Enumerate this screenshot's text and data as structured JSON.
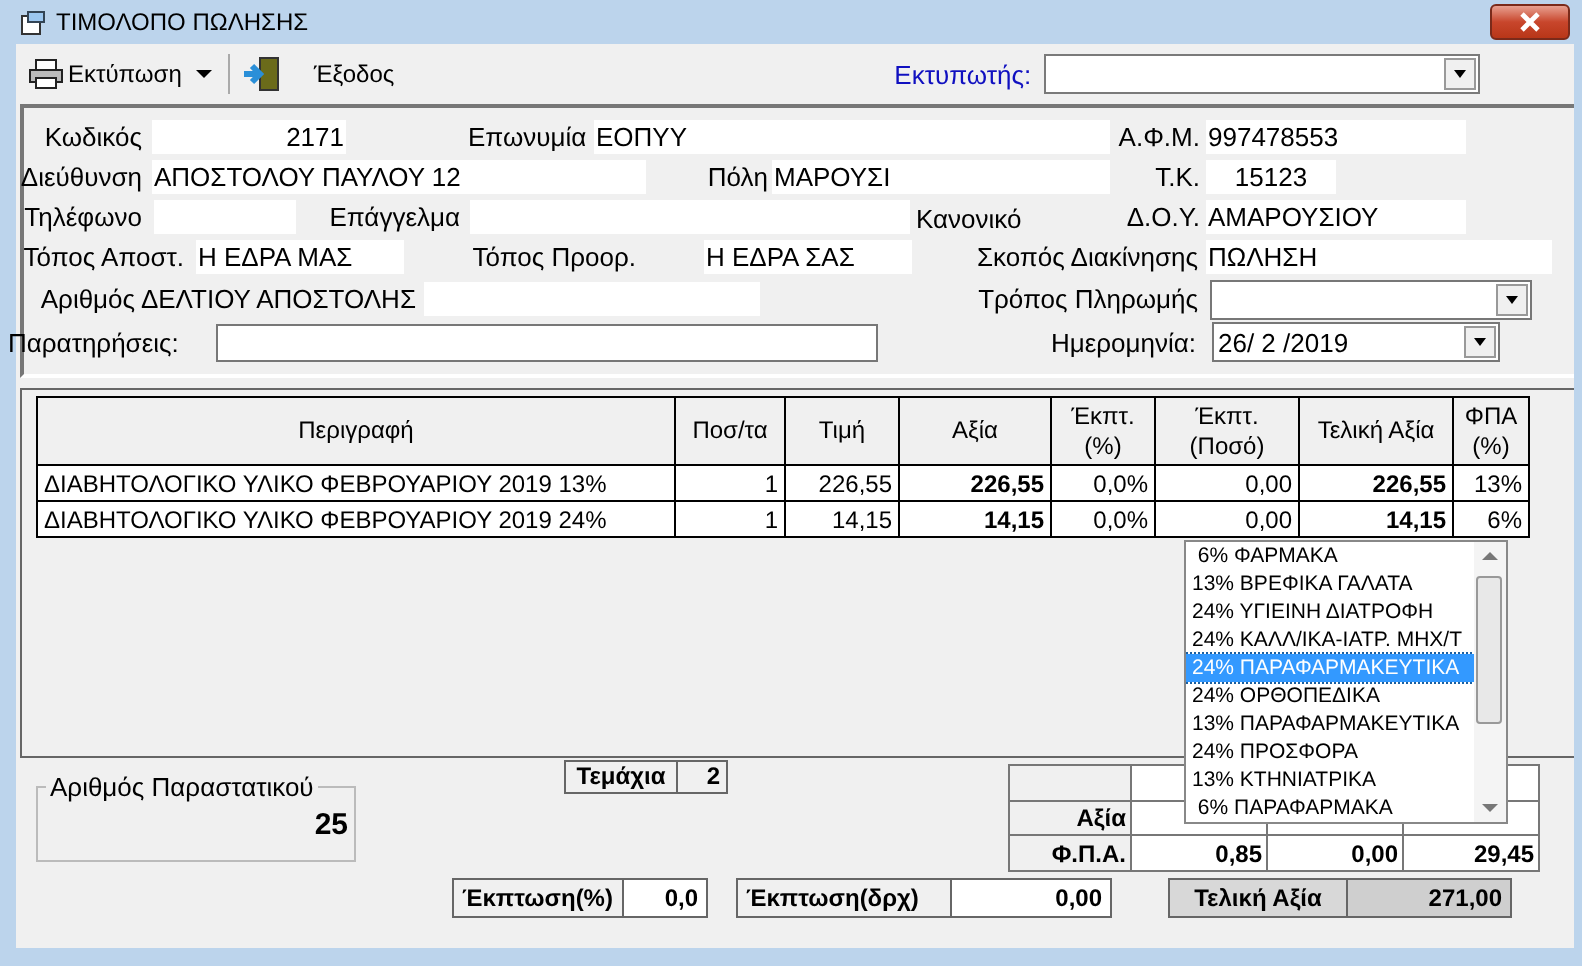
{
  "window": {
    "title": "ΤΙΜΟΛΟΠΟ ΠΩΛΗΣΗΣ"
  },
  "toolbar": {
    "print_button": "Εκτύπωση",
    "exit_button": "Έξοδος",
    "printer_label": "Εκτυπωτής:"
  },
  "form": {
    "rows": [
      [
        {
          "kind": "label",
          "text": "Κωδικός"
        },
        {
          "kind": "field",
          "value": "2171"
        },
        {
          "kind": "label",
          "text": "Επωνυμία"
        },
        {
          "kind": "field",
          "value": "ΕΟΠΥΥ"
        },
        {
          "kind": "label",
          "text": "Α.Φ.Μ."
        },
        {
          "kind": "field",
          "value": "997478553"
        }
      ],
      [
        {
          "kind": "label",
          "text": "Διεύθυνση"
        },
        {
          "kind": "field",
          "value": "ΑΠΟΣΤΟΛΟΥ ΠΑΥΛΟΥ 12"
        },
        {
          "kind": "label",
          "text": "Πόλη"
        },
        {
          "kind": "field",
          "value": "ΜΑΡΟΥΣΙ"
        },
        {
          "kind": "label",
          "text": "Τ.Κ."
        },
        {
          "kind": "field",
          "value": "15123"
        }
      ],
      [
        {
          "kind": "label",
          "text": "Τηλέφωνο"
        },
        {
          "kind": "field"
        },
        {
          "kind": "label",
          "text": "Επάγγελμα"
        },
        {
          "kind": "field",
          "suffix": "Κανονικό"
        },
        {
          "kind": "label",
          "text": "Δ.Ο.Υ."
        },
        {
          "kind": "field",
          "value": "ΑΜΑΡΟΥΣΙΟΥ"
        }
      ],
      [
        {
          "kind": "label",
          "text": "Τόπος Αποστ."
        },
        {
          "kind": "field",
          "value": "Η ΕΔΡΑ ΜΑΣ"
        },
        {
          "kind": "label",
          "text": "Τόπος Προορ."
        },
        {
          "kind": "field",
          "value": "Η ΕΔΡΑ ΣΑΣ"
        },
        {
          "kind": "label",
          "text": "Σκοπός Διακίνησης"
        },
        {
          "kind": "field",
          "value": "ΠΩΛΗΣΗ"
        }
      ],
      [
        {
          "kind": "label",
          "text": "Αριθμός ΔΕΛΤΙΟΥ ΑΠΟΣΤΟΛΗΣ"
        },
        {
          "kind": "field"
        },
        "",
        "",
        {
          "kind": "label",
          "text": "Τρόπος Πληρωμής"
        },
        {
          "kind": "combo"
        }
      ],
      [
        {
          "kind": "label",
          "text": "Παρατηρήσεις:"
        },
        {
          "kind": "box"
        },
        "",
        "",
        {
          "kind": "label",
          "text": "Ημερομηνία:"
        },
        {
          "kind": "combo",
          "value": "26/ 2 /2019"
        }
      ]
    ]
  },
  "table": {
    "columns": [
      {
        "label": "Περιγραφή",
        "bold": false
      },
      {
        "label": "Ποσ/τα",
        "bold": false
      },
      {
        "label": "Τιμή",
        "bold": false
      },
      {
        "label": "Αξία",
        "bold": true
      },
      {
        "label": "Έκπτ.\n(%)",
        "bold": false
      },
      {
        "label": "Έκπτ.\n(Ποσό)",
        "bold": false
      },
      {
        "label": "Τελική Αξία",
        "bold": true
      },
      {
        "label": "ΦΠΑ\n(%)",
        "bold": false
      }
    ],
    "rows": [
      [
        "ΔΙΑΒΗΤΟΛΟΓΙΚΟ ΥΛΙΚΟ ΦΕΒΡΟΥΑΡΙΟΥ 2019 13%",
        "1",
        "226,55",
        "226,55",
        "0,0%",
        "0,00",
        "226,55",
        "13%"
      ],
      [
        "ΔΙΑΒΗΤΟΛΟΓΙΚΟ ΥΛΙΚΟ ΦΕΒΡΟΥΑΡΙΟΥ 2019 24%",
        "1",
        "14,15",
        "14,15",
        "0,0%",
        "0,00",
        "14,15",
        "6%"
      ]
    ]
  },
  "dropdown": {
    "items": [
      {
        "label": " 6% ΦΑΡΜΑΚΑ",
        "selected": false
      },
      {
        "label": "13% ΒΡΕΦΙΚΑ ΓΑΛΑΤΑ",
        "selected": false
      },
      {
        "label": "24% ΥΓΙΕΙΝΗ ΔΙΑΤΡΟΦΗ",
        "selected": false
      },
      {
        "label": "24% ΚΑΛΛ/ΙΚΑ-ΙΑΤΡ. ΜΗΧ/Τ",
        "selected": false
      },
      {
        "label": "24% ΠΑΡΑΦΑΡΜΑΚΕΥΤΙΚΑ",
        "selected": true
      },
      {
        "label": "24% ΟΡΘΟΠΕΔΙΚΑ",
        "selected": false
      },
      {
        "label": "13% ΠΑΡΑΦΑΡΜΑΚΕΥΤΙΚΑ",
        "selected": false
      },
      {
        "label": "24% ΠΡΟΣΦΟΡΑ",
        "selected": false
      },
      {
        "label": "13% ΚΤΗΝΙΑΤΡΙΚΑ",
        "selected": false
      },
      {
        "label": " 6% ΠΑΡΑΦΑΡΜΑΚΑ",
        "selected": false
      }
    ]
  },
  "pieces": {
    "label": "Τεμάχια",
    "value": "2"
  },
  "document_number": {
    "label": "Αριθμός Παραστατικού",
    "value": "25"
  },
  "summary": {
    "rows": [
      {
        "label": "Αξία"
      },
      {
        "label": "Φ.Π.Α.",
        "values": [
          "0,85",
          "0,00",
          "29,45"
        ]
      }
    ]
  },
  "totals": {
    "discount_percent_label": "Έκπτωση(%)",
    "discount_percent": "0,0",
    "discount_amount_label": "Έκπτωση(δρχ)",
    "discount_amount": "0,00",
    "final_label": "Τελική Αξία",
    "final_value": "271,00"
  }
}
